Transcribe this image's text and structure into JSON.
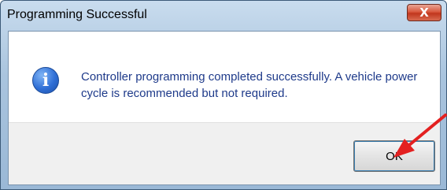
{
  "window": {
    "title": "Programming Successful",
    "close_label": "X"
  },
  "dialog": {
    "icon": "info-icon",
    "icon_glyph": "i",
    "message": "Controller programming completed successfully. A vehicle power cycle is recommended but not required."
  },
  "buttons": {
    "ok_label": "OK"
  },
  "colors": {
    "message_text": "#1e3a8a",
    "annotation_arrow": "#e32020",
    "close_button": "#c1361d"
  }
}
